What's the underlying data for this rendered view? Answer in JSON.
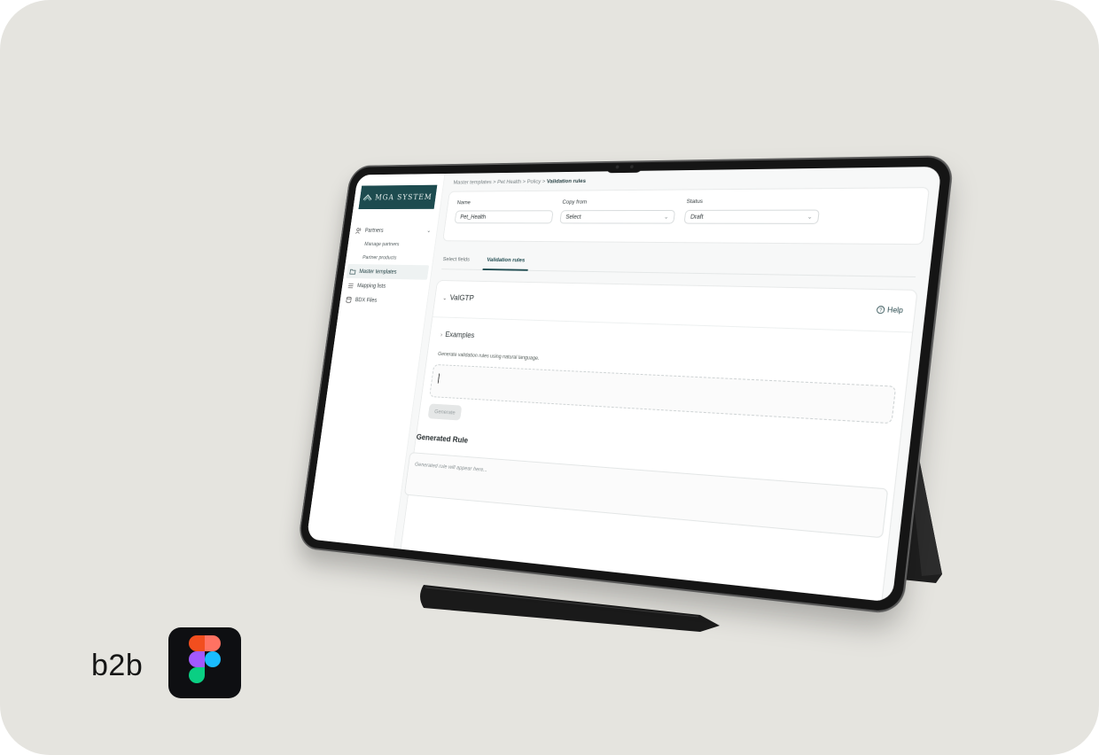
{
  "brand": {
    "label": "b2b",
    "figma_icon": "figma-logo-icon"
  },
  "device": {
    "logo_text": "MGA SYSTEM",
    "sidebar": {
      "items": [
        {
          "label": "Partners",
          "icon": "users-icon",
          "expanded": true
        },
        {
          "label": "Manage partners",
          "sub": true
        },
        {
          "label": "Partner products",
          "sub": true
        },
        {
          "label": "Master templates",
          "icon": "folder-icon",
          "active": true
        },
        {
          "label": "Mapping lists",
          "icon": "list-icon"
        },
        {
          "label": "BDX Files",
          "icon": "database-icon"
        }
      ]
    },
    "breadcrumb": {
      "path": "Master templates > Pet Health > Policy > ",
      "current": "Validation rules"
    },
    "form": {
      "name_label": "Name",
      "name_value": "Pet_Health",
      "copy_label": "Copy from",
      "copy_value": "Select",
      "status_label": "Status",
      "status_value": "Draft"
    },
    "tabs": {
      "select_fields": "Select fields",
      "validation_rules": "Validation rules",
      "active": "Validation rules"
    },
    "rule": {
      "title": "ValGTP",
      "help": "Help",
      "examples": "Examples",
      "hint": "Generate validation rules using natural language.",
      "prompt_value": "",
      "generate": "Generate",
      "generated_title": "Generated Rule",
      "generated_placeholder": "Generated rule will appear here..."
    },
    "colors": {
      "brand_teal": "#1d4b4f",
      "accent": "#1f4b50",
      "background": "#e5e4df"
    }
  }
}
